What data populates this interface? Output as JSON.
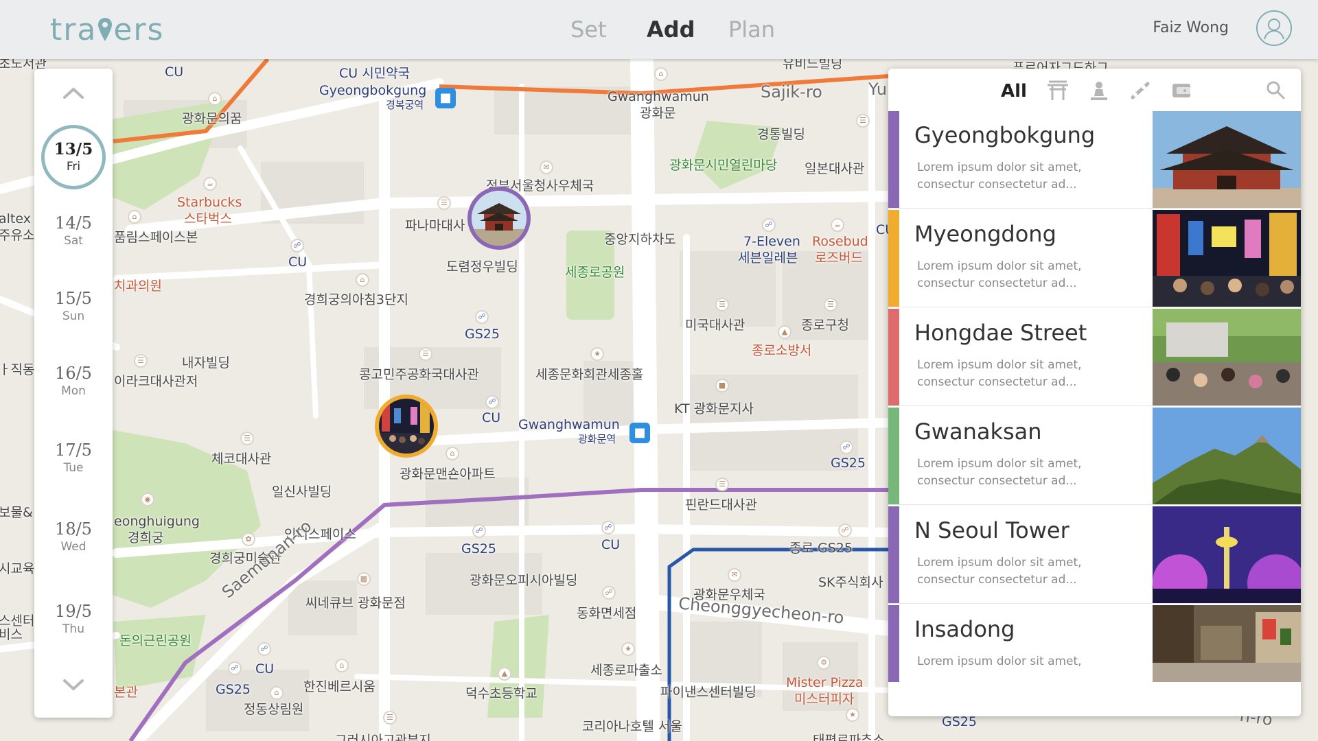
{
  "app": {
    "logo_text": "travers",
    "nav": [
      "Set",
      "Add",
      "Plan"
    ],
    "active_nav": "Add",
    "user_name": "Faiz Wong",
    "avatar_icon": "user-icon",
    "accent_color": "#7fadb3"
  },
  "dates": {
    "items": [
      {
        "date": "13/5",
        "weekday": "Fri",
        "active": true
      },
      {
        "date": "14/5",
        "weekday": "Sat"
      },
      {
        "date": "15/5",
        "weekday": "Sun"
      },
      {
        "date": "16/5",
        "weekday": "Mon"
      },
      {
        "date": "17/5",
        "weekday": "Tue"
      },
      {
        "date": "18/5",
        "weekday": "Wed"
      },
      {
        "date": "19/5",
        "weekday": "Thu"
      }
    ],
    "up_icon": "chevron-up-icon",
    "down_icon": "chevron-down-icon"
  },
  "filters": {
    "all_label": "All",
    "icons": [
      "temple-icon",
      "landmark-icon",
      "food-icon",
      "shopping-icon"
    ],
    "search_icon": "search-icon"
  },
  "places": [
    {
      "name": "Gyeongbokgung",
      "desc": "Lorem ipsum dolor sit amet, consectur consectetur ad...",
      "color": "#8a68b5"
    },
    {
      "name": "Myeongdong",
      "desc": "Lorem ipsum dolor sit amet, consectur consectetur ad...",
      "color": "#efac2f"
    },
    {
      "name": "Hongdae Street",
      "desc": "Lorem ipsum dolor sit amet, consectur consectetur ad...",
      "color": "#df6c6c"
    },
    {
      "name": "Gwanaksan",
      "desc": "Lorem ipsum dolor sit amet, consectur consectetur ad...",
      "color": "#76b77a"
    },
    {
      "name": "N Seoul Tower",
      "desc": "Lorem ipsum dolor sit amet, consectur consectetur ad...",
      "color": "#8a68b5"
    },
    {
      "name": "Insadong",
      "desc": "Lorem ipsum dolor sit amet,",
      "color": "#8a68b5"
    }
  ],
  "map": {
    "labels": {
      "cu1": "CU 시민약국",
      "gyeongbokgung_st": "Gyeongbokgung",
      "gyeongbokgung_st_kr": "경복궁역",
      "gwanghwamun_n": "Gwanghwamun",
      "gwanghwamun_n_kr": "광화문",
      "sajik": "Sajik-ro",
      "yu": "Yu",
      "top_partial": "유비느빌딩",
      "top_partial2": "푸르어자그드하그",
      "cu_tl": "CU",
      "gwanghwamun_kkum": "광화문의꿈",
      "starbucks": "Starbucks",
      "starbucks_kr": "스타벅스",
      "caltex": "altex",
      "caltex_kr": "주유소",
      "pumrim": "품림스페이스본",
      "dental": "치과의원",
      "cu_mid": "CU",
      "panama": "파나마대사",
      "post_office_seoul": "정부서울청사우체국",
      "dorim": "도렴정우빌딩",
      "kyunghee": "경희궁의아침3단지",
      "naeja": "내자빌딩",
      "iraq": "이라크대사관저",
      "gs25_a": "GS25",
      "congo": "콩고민주공화국대사관",
      "sejong_hall": "세종문화회관세종홀",
      "cu_c": "CU",
      "gwanghwamun_st": "Gwanghwamun",
      "gwanghwamun_st_kr": "광화문역",
      "czech": "체코대사관",
      "ilsin": "일신사빌딩",
      "gwanghwamun_mansion": "광화문맨숀아파트",
      "jungang_underpass": "중앙지하차도",
      "sejongro_park": "세종로공원",
      "citizens_yard": "광화문시민열린마당",
      "gyeongtong": "경통빌딩",
      "japan_embassy": "일본대사관",
      "seven_eleven": "7-Eleven",
      "seven_eleven_kr": "세븐일레븐",
      "rosebud": "Rosebud",
      "rosebud_kr": "로즈버드",
      "cu_r": "CU",
      "us_embassy": "미국대사관",
      "jongno_gu": "종로구청",
      "fire_station": "종로소방서",
      "kt": "KT 광화문지사",
      "gs25_r": "GS25",
      "finland": "핀란드대사관",
      "gyeonghuigung": "eonghuigung",
      "gyeonghuigung_kr": "경희궁",
      "indie": "인디스페이스",
      "museum": "경희궁미술관",
      "gs25_b": "GS25",
      "cu_d": "CU",
      "olympia": "광화문오피시아빌딩",
      "duty_free": "동화면세점",
      "cinecube": "씨네큐브 광화문점",
      "saemunan": "Saemunan-ro",
      "jongno_gs25": "종로 GS25",
      "sk": "SK주식회사",
      "post_office_gwh": "광화문우체국",
      "cheonggye": "Cheonggyecheon-ro",
      "sejongro_police": "세종로파출소",
      "mister_pizza": "Mister Pizza",
      "mister_pizza_kr": "미스터피자",
      "finance_center": "파이낸스센터빌딩",
      "cu_e": "CU",
      "gs25_c": "GS25",
      "hanjin": "한진베르시움",
      "jeongdong": "정동상림원",
      "doneui_park": "돈의근린공원",
      "deoksu_school": "덕수초등학교",
      "koreana": "코리아나호텔 서울",
      "gs25_bottom": "GS25",
      "bonkwan": "본관",
      "left_edge1": "ㅏ직동",
      "left_edge2": "보물&",
      "left_edge3": "시교육",
      "left_edge4": "스센터",
      "left_edge5": "비스",
      "right_edge1": "Cl",
      "bottom_road": "n-ro",
      "top_left": "초노서관",
      "bottom1": "그러시아고관부지",
      "bottom2": "태평로파추소"
    }
  }
}
